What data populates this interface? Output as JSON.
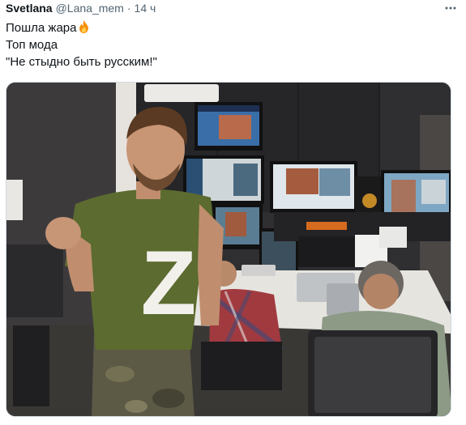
{
  "tweet": {
    "author_name": "Svetlana",
    "handle": "@Lana_mem",
    "separator": "·",
    "time": "14 ч",
    "more_icon": "more-horizontal-icon",
    "text_lines": [
      "Пошла жара",
      "Топ мода",
      "\"Не стыдно быть русским!\""
    ],
    "emoji": "fire-icon"
  },
  "media": {
    "shirt_letter": "Z"
  },
  "colors": {
    "text_primary": "#0f1419",
    "text_secondary": "#536471",
    "border": "#cfd9de",
    "shirt": "#5c6b2f"
  }
}
